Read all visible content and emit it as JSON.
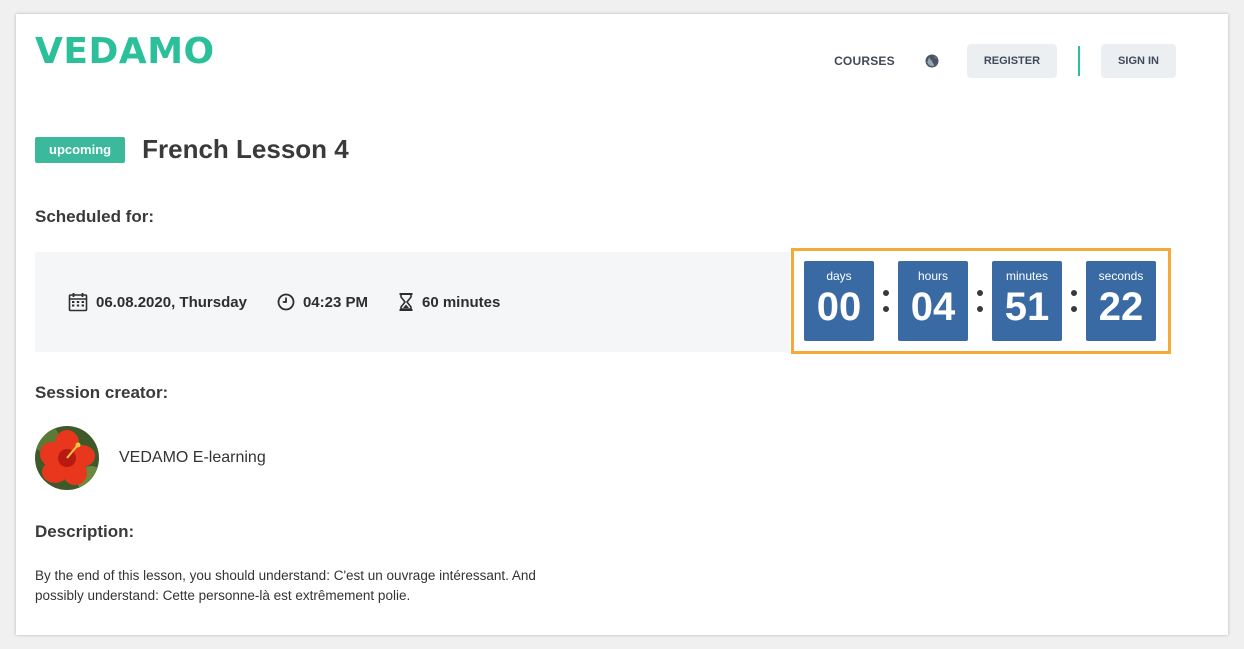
{
  "brand": {
    "logo_text": "VEDAMO",
    "accent_color": "#2bbf9a"
  },
  "nav": {
    "courses_label": "COURSES",
    "globe_icon": "globe-icon",
    "register_label": "REGISTER",
    "signin_label": "SIGN IN"
  },
  "session": {
    "status_badge": "upcoming",
    "status_color": "#3cb89c",
    "title": "French Lesson 4"
  },
  "schedule": {
    "heading": "Scheduled for:",
    "date": "06.08.2020, Thursday",
    "time": "04:23 PM",
    "duration": "60 minutes"
  },
  "countdown": {
    "border_color": "#f5a93b",
    "box_color": "#3a6aa3",
    "units": [
      {
        "label": "days",
        "value": "00"
      },
      {
        "label": "hours",
        "value": "04"
      },
      {
        "label": "minutes",
        "value": "51"
      },
      {
        "label": "seconds",
        "value": "22"
      }
    ]
  },
  "creator": {
    "heading": "Session creator:",
    "name": "VEDAMO E-learning"
  },
  "description": {
    "heading": "Description:",
    "text": "By the end of this lesson, you should understand: C'est un ouvrage intéressant. And possibly understand: Cette personne-là est extrêmement polie."
  }
}
